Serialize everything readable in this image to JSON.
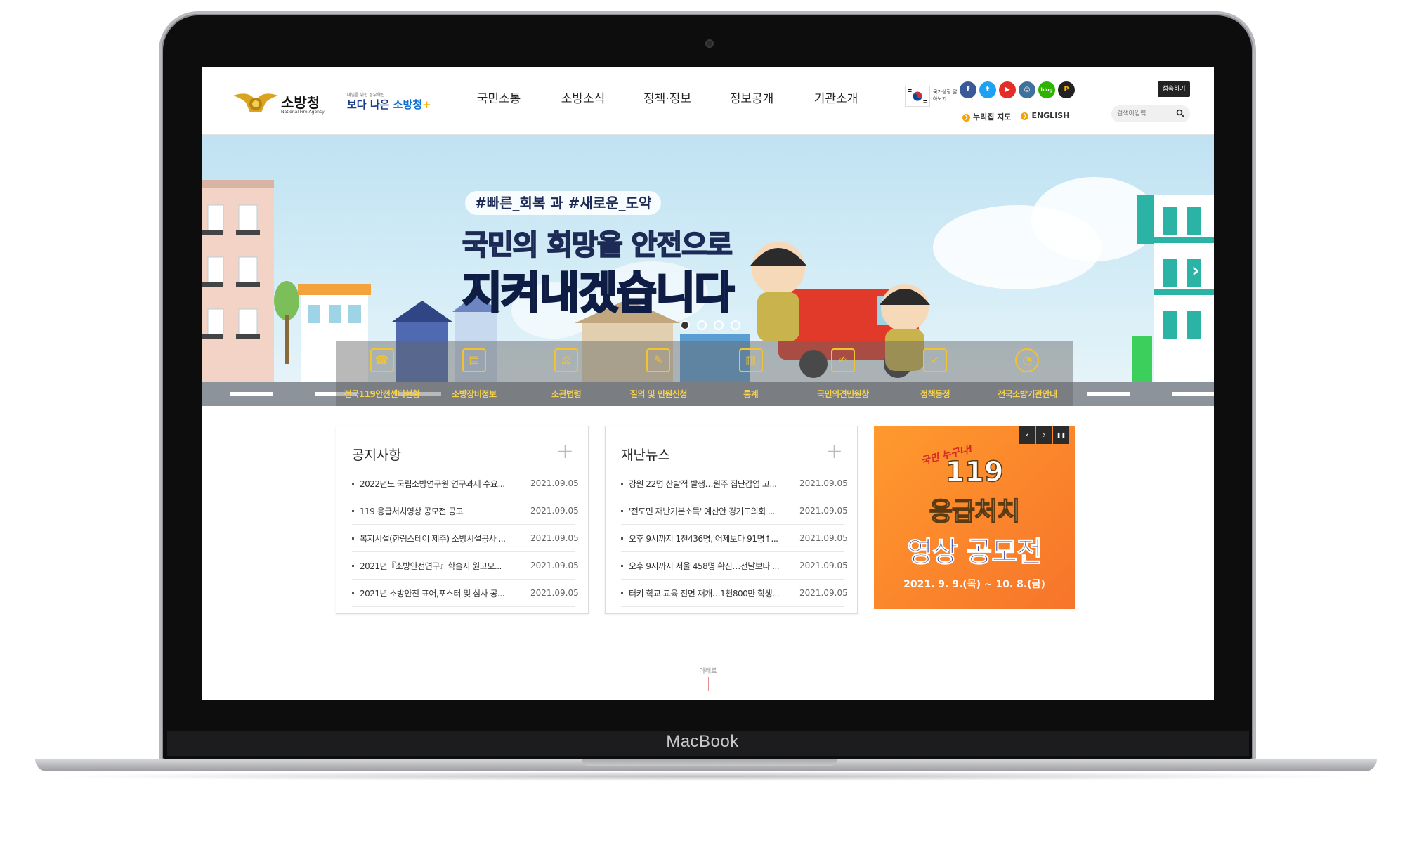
{
  "device": {
    "brand": "MacBook"
  },
  "header": {
    "logo_text": "소방청",
    "logo_sub": "National Fire Agency",
    "slogan_small": "내일을 위한 정부혁신",
    "slogan_prefix": "보다 나은",
    "slogan_main": "소방청",
    "nav": [
      "국민소통",
      "소방소식",
      "정책·정보",
      "정보공개",
      "기관소개"
    ],
    "flag_label": "국가상징 알아보기",
    "sns": [
      "f",
      "t",
      "▶",
      "◎",
      "blog",
      "P"
    ],
    "util_links": [
      "누리집 지도",
      "ENGLISH"
    ],
    "access_button": "접속하기",
    "search_placeholder": "검색어입력"
  },
  "hero": {
    "hashtag": "#빠른_회복 과 #새로운_도약",
    "headline1": "국민의 희망을 안전으로",
    "headline2": "지켜내겠습니다",
    "slide_count": 4,
    "active_slide": 1,
    "quick_links": [
      {
        "icon": "☎",
        "label": "전국119안전센터현황"
      },
      {
        "icon": "▤",
        "label": "소방장비정보"
      },
      {
        "icon": "⚖",
        "label": "소관법령"
      },
      {
        "icon": "✎",
        "label": "질의 및 민원신청"
      },
      {
        "icon": "▥",
        "label": "통계"
      },
      {
        "icon": "✍",
        "label": "국민의견민원창"
      },
      {
        "icon": "✓",
        "label": "정책동정"
      },
      {
        "icon": "◔",
        "label": "전국소방기관안내"
      }
    ]
  },
  "notices": {
    "title": "공지사항",
    "items": [
      {
        "title": "2022년도 국립소방연구원 연구과제 수요...",
        "date": "2021.09.05"
      },
      {
        "title": "119 응급처치영상 공모전 공고",
        "date": "2021.09.05"
      },
      {
        "title": "복지시설(한림스테이 제주) 소방시설공사 ...",
        "date": "2021.09.05"
      },
      {
        "title": "2021년『소방안전연구』학술지 원고모...",
        "date": "2021.09.05"
      },
      {
        "title": "2021년 소방안전 표어,포스터 및 심사 공...",
        "date": "2021.09.05"
      }
    ]
  },
  "news": {
    "title": "재난뉴스",
    "items": [
      {
        "title": "강원 22명 산발적 발생…원주 집단감염 고...",
        "date": "2021.09.05"
      },
      {
        "title": "'전도민 재난기본소득' 예산안 경기도의회 ...",
        "date": "2021.09.05"
      },
      {
        "title": "오후 9시까지 1천436명, 어제보다 91명↑...",
        "date": "2021.09.05"
      },
      {
        "title": "오후 9시까지 서울 458명 확진…전날보다 ...",
        "date": "2021.09.05"
      },
      {
        "title": "터키 학교 교육 전면 재개…1천800만 학생...",
        "date": "2021.09.05"
      }
    ]
  },
  "banner": {
    "script": "국민 누구나!",
    "line1": "119",
    "line2": "응급처치",
    "line3": "영상 공모전",
    "date": "2021. 9. 9.(목) ~ 10. 8.(금)",
    "controls": [
      "‹",
      "›",
      "❚❚"
    ]
  },
  "scroll_label": "아래로"
}
